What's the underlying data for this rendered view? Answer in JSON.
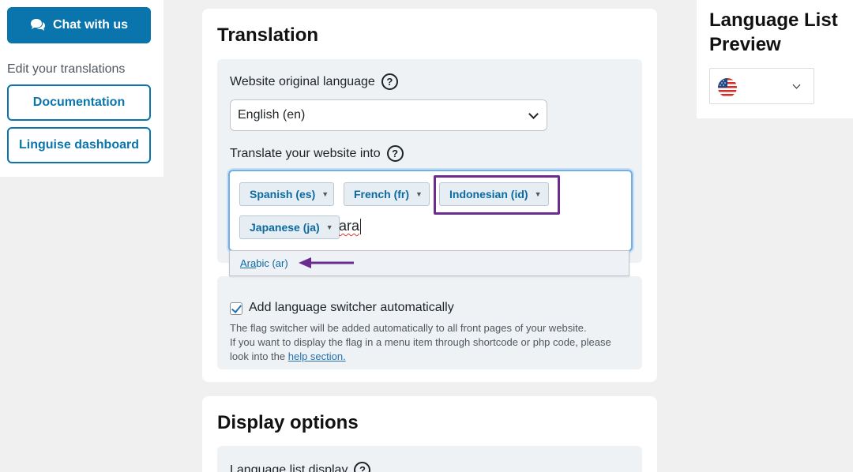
{
  "sidebar": {
    "chat_label": "Chat with us",
    "edit_label": "Edit your translations",
    "documentation_label": "Documentation",
    "dashboard_label": "Linguise dashboard"
  },
  "translation": {
    "title": "Translation",
    "original_language_label": "Website original language",
    "original_language_value": "English (en)",
    "translate_into_label": "Translate your website into",
    "selected_languages": [
      "Spanish (es)",
      "French (fr)",
      "Indonesian (id)",
      "Japanese (ja)"
    ],
    "search_typed": "ara",
    "dropdown_option_underlined": "Ara",
    "dropdown_option_rest": "bic (ar)",
    "switcher_label": "Add language switcher automatically",
    "switcher_checked": true,
    "switcher_desc_1": "The flag switcher will be added automatically to all front pages of your website.",
    "switcher_desc_2": "If you want to display the flag in a menu item through shortcode or php code, please look into the",
    "help_link": "help section."
  },
  "display": {
    "title": "Display options",
    "list_display_label": "Language list display"
  },
  "preview": {
    "title": "Language List Preview",
    "flag_icon": "us-flag-icon"
  },
  "colors": {
    "accent": "#0a75ad",
    "highlight": "#6b2c91",
    "focus": "#72aee6"
  }
}
